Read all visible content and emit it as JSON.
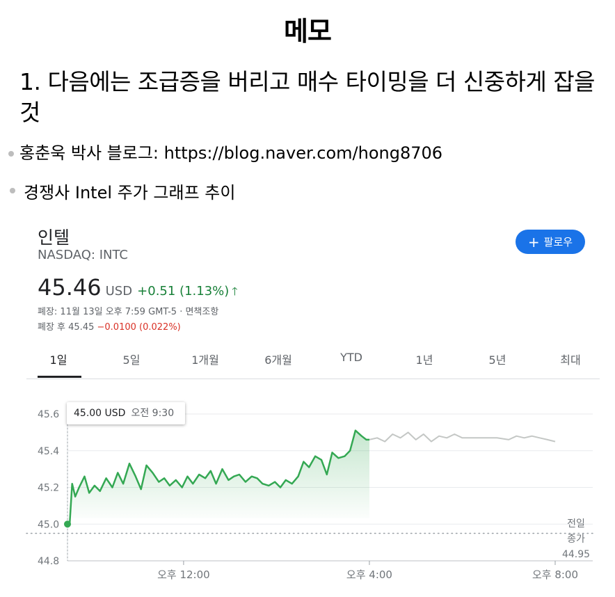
{
  "slide": {
    "title": "메모",
    "heading": "1. 다음에는 조급증을 버리고 매수 타이밍을 더 신중하게 잡을 것",
    "bullets": [
      "홍춘욱 박사 블로그: https://blog.naver.com/hong8706",
      "경쟁사 Intel 주가 그래프 추이"
    ]
  },
  "stock": {
    "name": "인텔",
    "exchange": "NASDAQ: INTC",
    "follow_label": "팔로우",
    "follow_icon": "plus-icon",
    "price": "45.46",
    "currency": "USD",
    "change": "+0.51 (1.13%)",
    "change_icon": "arrow-up-icon",
    "close_info": "폐장: 11월 13일 오후 7:59 GMT-5 · 면책조항",
    "after_hours_label": "폐장 후 45.45",
    "after_hours_change": "−0.0100 (0.022%)"
  },
  "tabs": [
    "1일",
    "5일",
    "1개월",
    "6개월",
    "YTD",
    "1년",
    "5년",
    "최대"
  ],
  "active_tab": "1일",
  "tooltip": {
    "price": "45.00 USD",
    "time": "오전 9:30"
  },
  "colors": {
    "up": "#188038",
    "line": "#34a853",
    "after_hours": "#c4c7c5",
    "down": "#d93025",
    "accent": "#1a73e8"
  },
  "chart_data": {
    "type": "line",
    "title": "",
    "xlabel": "",
    "ylabel": "",
    "x_ticks": [
      "오후 12:00",
      "오후 4:00",
      "오후 8:00"
    ],
    "y_ticks": [
      "44.8",
      "45.0",
      "45.2",
      "45.4",
      "45.6"
    ],
    "ylim": [
      44.8,
      45.65
    ],
    "previous_close": {
      "label_lines": [
        "전일",
        "종가"
      ],
      "value": "44.95"
    },
    "grid": true,
    "series": [
      {
        "session": "regular",
        "x": [
          "9:30",
          "9:33",
          "9:36",
          "9:40",
          "9:45",
          "9:52",
          "9:58",
          "10:05",
          "10:12",
          "10:20",
          "10:28",
          "10:35",
          "10:42",
          "10:50",
          "10:58",
          "11:05",
          "11:12",
          "11:20",
          "11:28",
          "11:35",
          "11:42",
          "11:50",
          "11:58",
          "12:05",
          "12:12",
          "12:20",
          "12:28",
          "12:35",
          "12:42",
          "12:50",
          "12:58",
          "13:05",
          "13:12",
          "13:20",
          "13:28",
          "13:35",
          "13:42",
          "13:50",
          "13:58",
          "14:05",
          "14:12",
          "14:20",
          "14:28",
          "14:35",
          "14:42",
          "14:50",
          "14:58",
          "15:05",
          "15:12",
          "15:20",
          "15:28",
          "15:35",
          "15:42",
          "15:50",
          "15:56",
          "16:00"
        ],
        "values": [
          45.0,
          45.01,
          45.22,
          45.15,
          45.2,
          45.26,
          45.17,
          45.21,
          45.18,
          45.25,
          45.2,
          45.28,
          45.22,
          45.33,
          45.26,
          45.19,
          45.32,
          45.28,
          45.23,
          45.25,
          45.21,
          45.24,
          45.2,
          45.26,
          45.22,
          45.27,
          45.25,
          45.29,
          45.22,
          45.3,
          45.24,
          45.26,
          45.27,
          45.23,
          45.26,
          45.25,
          45.22,
          45.21,
          45.23,
          45.2,
          45.24,
          45.22,
          45.26,
          45.34,
          45.31,
          45.37,
          45.35,
          45.27,
          45.39,
          45.36,
          45.37,
          45.4,
          45.51,
          45.48,
          45.46,
          45.46
        ]
      },
      {
        "session": "after_hours",
        "x": [
          "16:00",
          "16:10",
          "16:20",
          "16:30",
          "16:40",
          "16:50",
          "17:00",
          "17:10",
          "17:20",
          "17:30",
          "17:40",
          "17:50",
          "18:00",
          "18:15",
          "18:30",
          "18:45",
          "19:00",
          "19:10",
          "19:20",
          "19:30",
          "19:40",
          "19:50",
          "20:00"
        ],
        "values": [
          45.46,
          45.47,
          45.45,
          45.49,
          45.47,
          45.5,
          45.46,
          45.49,
          45.45,
          45.48,
          45.47,
          45.49,
          45.47,
          45.47,
          45.47,
          45.47,
          45.46,
          45.48,
          45.47,
          45.48,
          45.47,
          45.46,
          45.45
        ]
      }
    ]
  }
}
